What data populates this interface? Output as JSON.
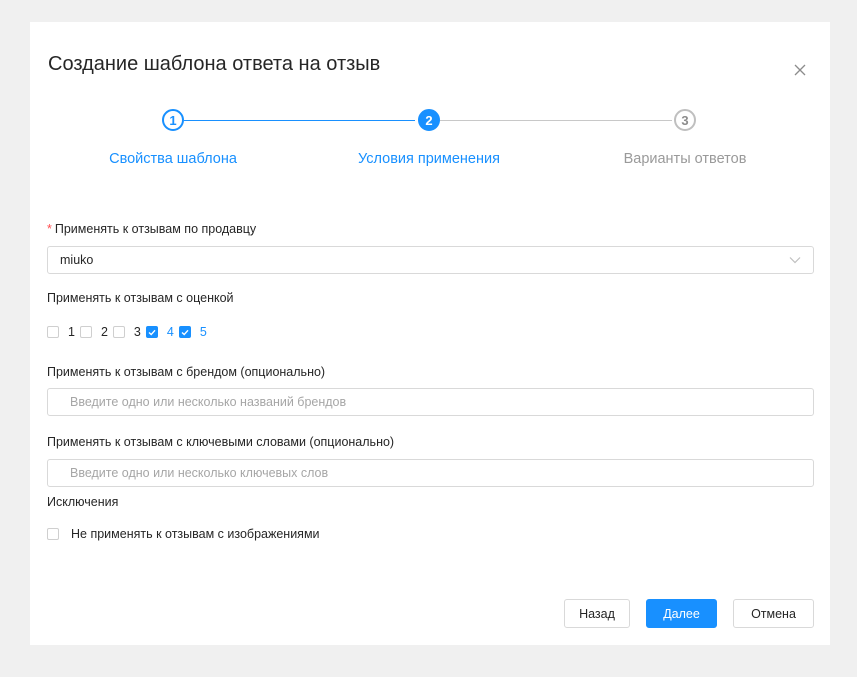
{
  "modal": {
    "title": "Создание шаблона ответа на отзыв",
    "close_icon": "close-icon"
  },
  "steps": [
    {
      "number": "1",
      "label": "Свойства шаблона",
      "status": "finished"
    },
    {
      "number": "2",
      "label": "Условия применения",
      "status": "current"
    },
    {
      "number": "3",
      "label": "Варианты ответов",
      "status": "pending"
    }
  ],
  "seller": {
    "required_mark": "*",
    "label": "Применять к отзывам по продавцу",
    "value": "miuko",
    "arrow_icon": "chevron-down-icon"
  },
  "rating": {
    "label": "Применять к отзывам с оценкой",
    "options": [
      {
        "value": "1",
        "checked": false
      },
      {
        "value": "2",
        "checked": false
      },
      {
        "value": "3",
        "checked": false
      },
      {
        "value": "4",
        "checked": true
      },
      {
        "value": "5",
        "checked": true
      }
    ]
  },
  "brand": {
    "label": "Применять к отзывам с брендом (опционально)",
    "placeholder": "Введите одно или несколько названий брендов",
    "value": ""
  },
  "keywords": {
    "label": "Применять к отзывам с ключевыми словами (опционально)",
    "placeholder": "Введите одно или несколько ключевых слов",
    "value": ""
  },
  "exclusions": {
    "label": "Исключения",
    "no_images": {
      "label": "Не применять к отзывам с изображениями",
      "checked": false
    }
  },
  "footer": {
    "back_label": "Назад",
    "next_label": "Далее",
    "cancel_label": "Отмена"
  },
  "colors": {
    "accent": "#1890ff",
    "required": "#ff4d4f",
    "page_background": "#f0f0f0"
  }
}
